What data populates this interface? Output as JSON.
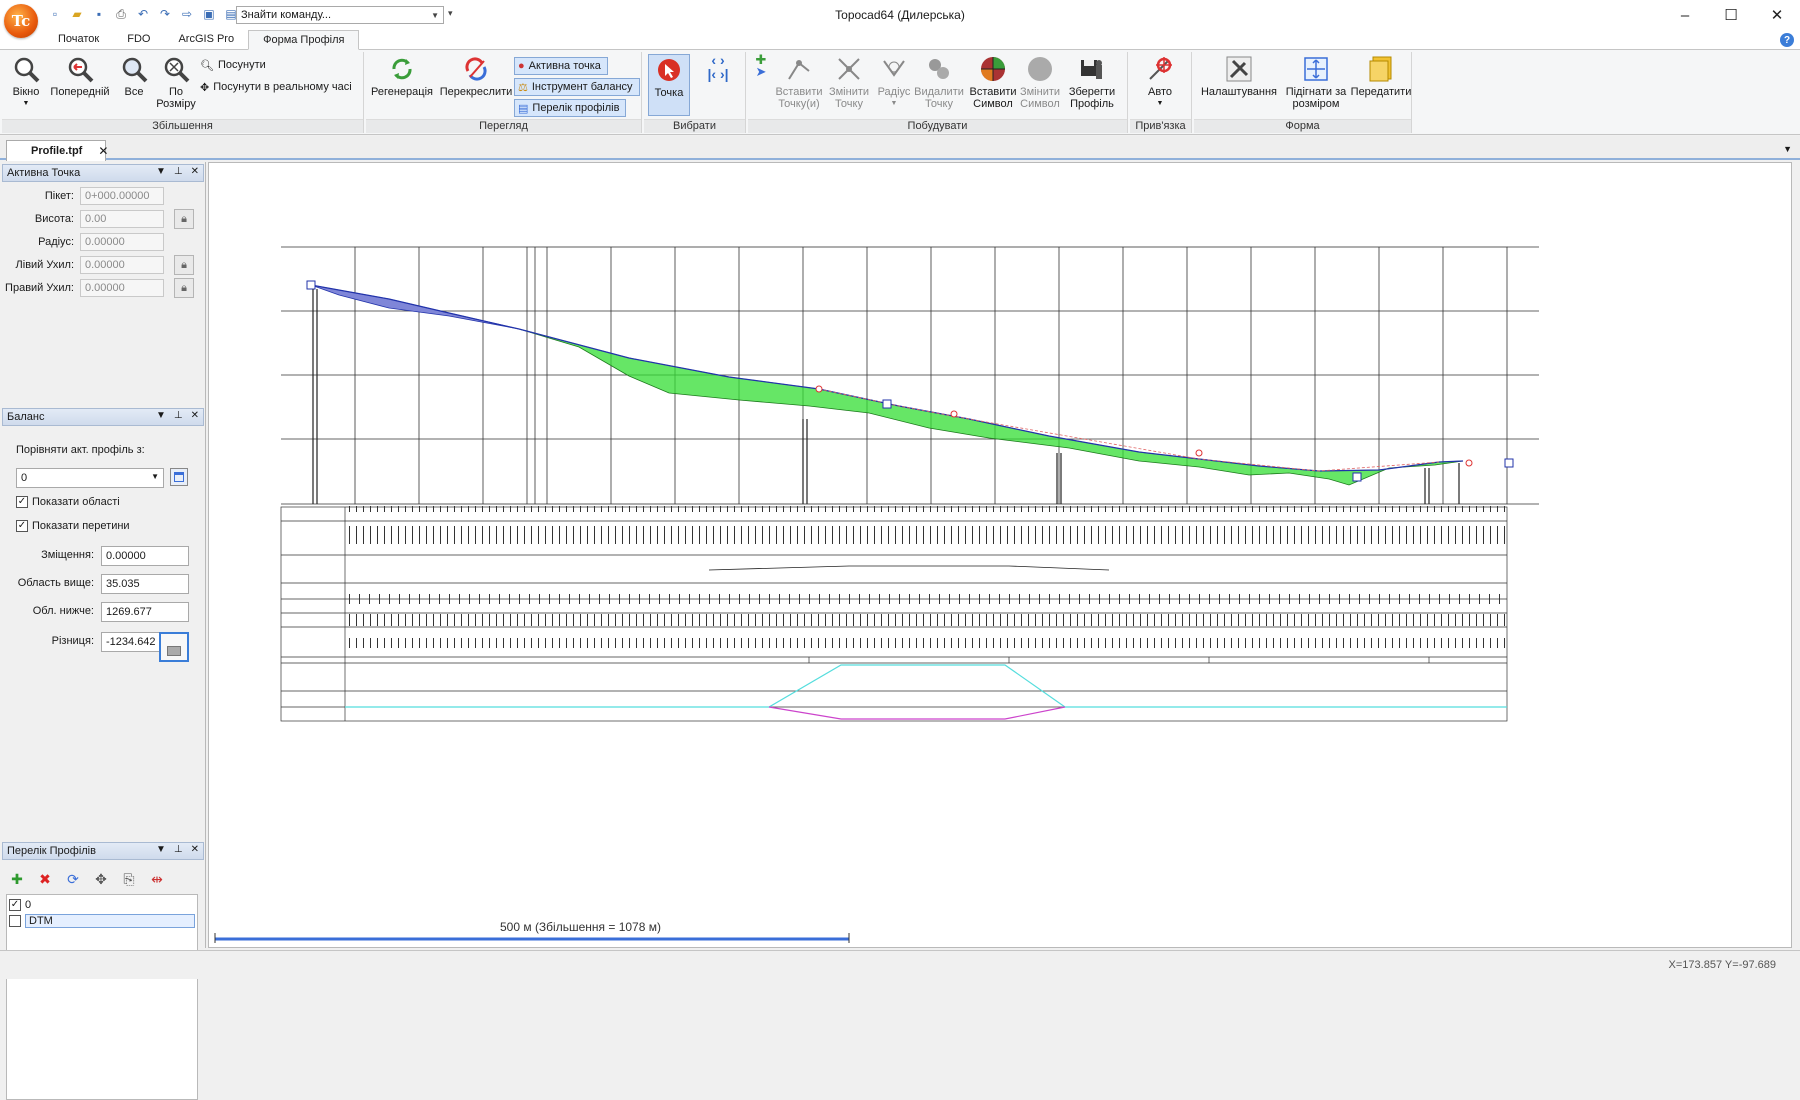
{
  "app": {
    "logo_text": "Tc",
    "window_title": "Topocad64 (Дилерська)",
    "command_search_placeholder": "Знайти команду..."
  },
  "ribbon_tabs": [
    "Початок",
    "FDO",
    "ArcGIS Pro",
    "Форма Профіля"
  ],
  "ribbon": {
    "zoom": {
      "label": "Збільшення",
      "window": "Вікно",
      "previous": "Попередній",
      "all": "Все",
      "by_size_1": "По",
      "by_size_2": "Розміру",
      "pan": "Посунути",
      "pan_realtime": "Посунути в реальному часі"
    },
    "view": {
      "label": "Перегляд",
      "regen": "Регенерація",
      "redraw": "Перекреслити",
      "active_point": "Активна точка",
      "balance_tool": "Інструмент балансу",
      "profile_list": "Перелік профілів"
    },
    "select": {
      "label": "Вибрати",
      "point": "Точка"
    },
    "build": {
      "label": "Побудувати",
      "insert_points_1": "Вставити",
      "insert_points_2": "Точку(и)",
      "change_point_1": "Змінити",
      "change_point_2": "Точку",
      "radius": "Радіус",
      "delete_point_1": "Видалити",
      "delete_point_2": "Точку",
      "insert_symbol_1": "Вставити",
      "insert_symbol_2": "Символ",
      "change_symbol_1": "Змінити",
      "change_symbol_2": "Символ",
      "save_profile_1": "Зберегти",
      "save_profile_2": "Профіль"
    },
    "snap": {
      "label": "Прив'язка",
      "auto": "Авто"
    },
    "form": {
      "label": "Форма",
      "settings": "Налаштування",
      "fit_1": "Підігнати за",
      "fit_2": "розміром",
      "transfer": "Передатити"
    }
  },
  "document": {
    "tab": "Profile.tpf"
  },
  "active_point_pane": {
    "title": "Активна Точка",
    "picket_label": "Пікет:",
    "picket_value": "0+000.00000",
    "height_label": "Висота:",
    "height_value": "0.00",
    "radius_label": "Радіус:",
    "radius_value": "0.00000",
    "left_slope_label": "Лівий Ухил:",
    "left_slope_value": "0.00000",
    "right_slope_label": "Правий Ухил:",
    "right_slope_value": "0.00000"
  },
  "balance_pane": {
    "title": "Баланс",
    "compare_label": "Порівняти акт. профіль з:",
    "compare_value": "0",
    "show_areas": "Показати області",
    "show_intersections": "Показати перетини",
    "offset_label": "Зміщення:",
    "offset_value": "0.00000",
    "area_above_label": "Область вище:",
    "area_above_value": "35.035",
    "area_below_label": "Обл. нижче:",
    "area_below_value": "1269.677",
    "difference_label": "Різниця:",
    "difference_value": "-1234.642"
  },
  "profile_list_pane": {
    "title": "Перелік Профілів",
    "items": [
      {
        "name": "0",
        "checked": true
      },
      {
        "name": "DTM",
        "checked": false
      }
    ]
  },
  "canvas": {
    "scale_text": "500 м (Збільшення = 1078 м)",
    "cut_color": "#33dd33",
    "fill_color": "#3344cc"
  },
  "status": {
    "coords": "X=173.857 Y=-97.689"
  }
}
